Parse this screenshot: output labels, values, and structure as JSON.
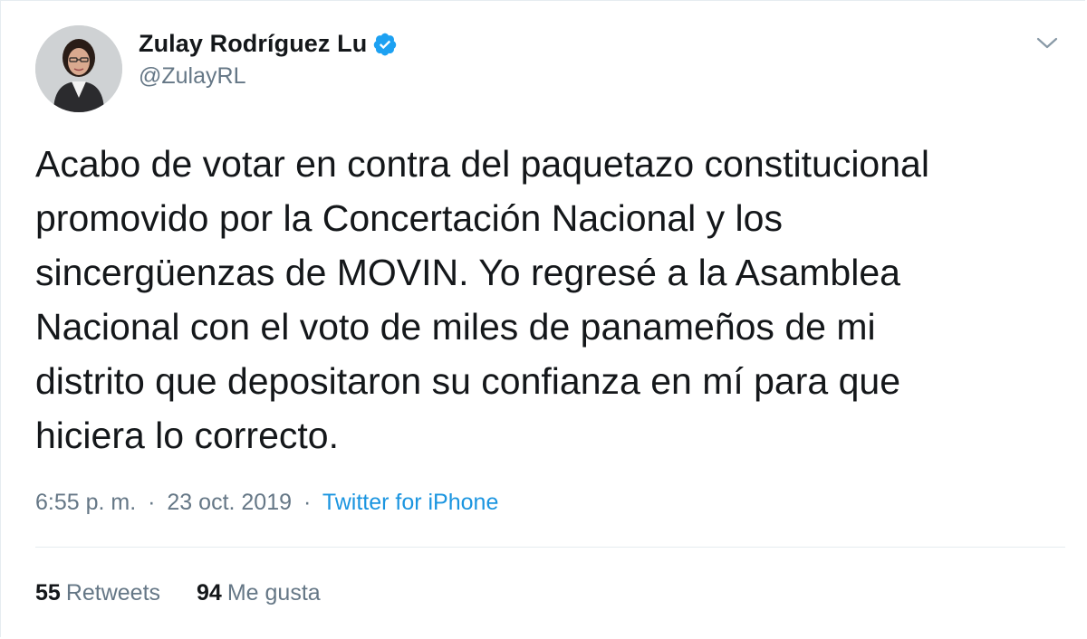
{
  "user": {
    "display_name": "Zulay Rodríguez Lu",
    "handle": "@ZulayRL",
    "verified_icon": "verified-badge-icon"
  },
  "tweet": {
    "text_lines": [
      "Acabo de votar en contra del paquetazo constitucional",
      "promovido por la Concertación Nacional y los",
      "sincergüenzas de MOVIN. Yo regresé a la Asamblea",
      "Nacional con el voto de miles de panameños de mi",
      "distrito que depositaron su confianza en mí para que",
      "hiciera lo correcto."
    ],
    "time": "6:55 p. m.",
    "separator": "·",
    "date": "23 oct. 2019",
    "source": "Twitter for iPhone"
  },
  "stats": {
    "retweets_count": "55",
    "retweets_label": "Retweets",
    "likes_count": "94",
    "likes_label": "Me gusta"
  },
  "colors": {
    "text": "#14171a",
    "secondary": "#657786",
    "link": "#1b95e0",
    "verified": "#1da1f2",
    "divider": "#e6ecf0"
  },
  "icons": {
    "caret": "chevron-down-icon"
  }
}
